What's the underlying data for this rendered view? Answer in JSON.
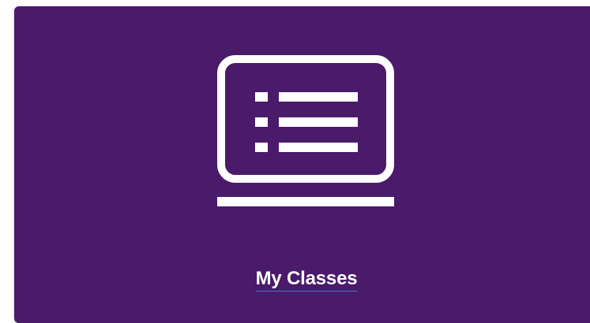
{
  "tile": {
    "label": "My Classes",
    "icon": "laptop-list-icon",
    "background_color": "#4a1a6b",
    "icon_color": "#ffffff",
    "link_underline_color": "#3f7dd1"
  }
}
